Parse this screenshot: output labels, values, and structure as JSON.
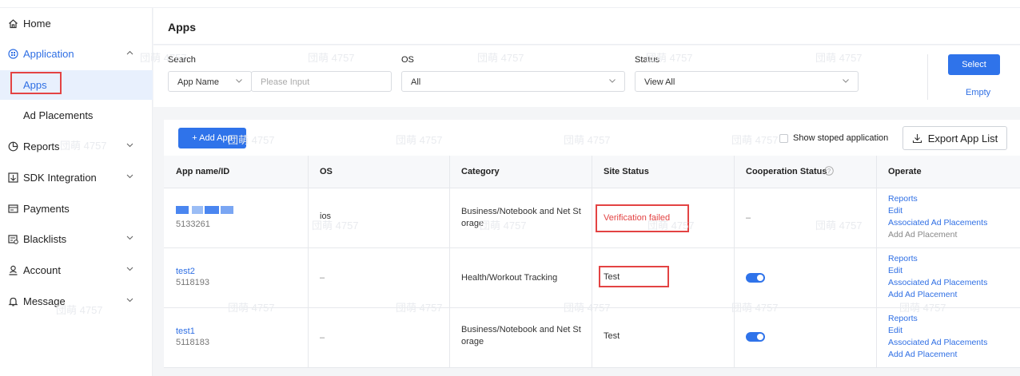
{
  "sidebar": {
    "home": "Home",
    "application": "Application",
    "apps": "Apps",
    "ad_placements": "Ad Placements",
    "reports": "Reports",
    "sdk": "SDK Integration",
    "payments": "Payments",
    "blacklists": "Blacklists",
    "account": "Account",
    "message": "Message"
  },
  "page": {
    "title": "Apps"
  },
  "filters": {
    "search_label": "Search",
    "search_type": "App Name",
    "search_placeholder": "Please Input",
    "os_label": "OS",
    "os_value": "All",
    "status_label": "Status",
    "status_value": "View All",
    "select_button": "Select",
    "empty_link": "Empty"
  },
  "toolbar": {
    "add_app": "+ Add App",
    "show_stopped": "Show stoped application",
    "export": "Export App List"
  },
  "table": {
    "columns": [
      "App name/ID",
      "OS",
      "Category",
      "Site Status",
      "Cooperation Status",
      "Operate"
    ],
    "rows": [
      {
        "name": "",
        "id": "5133261",
        "os": "ios",
        "category_l1": "Business/Notebook and Net St",
        "category_l2": "orage",
        "site_status": "Verification failed",
        "cooperation": "–",
        "ops": [
          "Reports",
          "Edit",
          "Associated Ad Placements",
          "Add Ad Placement"
        ]
      },
      {
        "name": "test2",
        "id": "5118193",
        "os": "–",
        "category_l1": "Health/Workout Tracking",
        "category_l2": "",
        "site_status": "Test",
        "cooperation_on": true,
        "ops": [
          "Reports",
          "Edit",
          "Associated Ad Placements",
          "Add Ad Placement"
        ]
      },
      {
        "name": "test1",
        "id": "5118183",
        "os": "–",
        "category_l1": "Business/Notebook and Net St",
        "category_l2": "orage",
        "site_status": "Test",
        "cooperation_on": true,
        "ops": [
          "Reports",
          "Edit",
          "Associated Ad Placements",
          "Add Ad Placement"
        ]
      }
    ]
  },
  "watermark": "団萌 4757",
  "colors": {
    "accent": "#2f73ea",
    "link": "#2f6fe4",
    "error": "#e34343"
  }
}
